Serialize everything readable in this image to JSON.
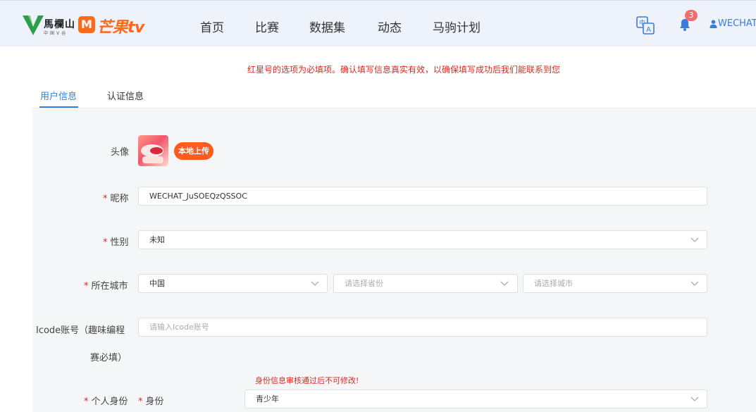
{
  "header": {
    "logo_cn": "馬欄山",
    "logo_sub": "中国V谷",
    "mango_icon": "M",
    "mango_text": "芒果tv",
    "nav": [
      "首页",
      "比赛",
      "数据集",
      "动态",
      "马驹计划"
    ],
    "notification_count": "3",
    "user_name": "WECHAT",
    "icons": {
      "translate": "translate-icon",
      "bell": "bell-icon",
      "user": "user-icon"
    }
  },
  "notice": "红星号的选项为必填项。确认填写信息真实有效，以确保填写成功后我们能联系到您",
  "tabs": [
    "用户信息",
    "认证信息"
  ],
  "form": {
    "avatar_label": "头像",
    "upload_label": "本地上传",
    "nickname_label": "昵称",
    "nickname_value": "WECHAT_JuSOEQzQSSOC",
    "gender_label": "性别",
    "gender_value": "未知",
    "city_label": "所在城市",
    "country_value": "中国",
    "province_placeholder": "请选择省份",
    "city_placeholder": "请选择城市",
    "icode_label_line1": "Icode账号（趣味编程",
    "icode_label_line2": "赛必填）",
    "icode_placeholder": "请输入Icode账号",
    "identity_warning": "身份信息审核通过后不可修改!",
    "personal_identity_label": "个人身份",
    "identity_label": "身份",
    "identity_value": "青少年"
  },
  "colors": {
    "accent": "#3a7be0",
    "brand": "#ff6a1a",
    "required": "#e0281e",
    "upload": "#ff5a1f"
  }
}
